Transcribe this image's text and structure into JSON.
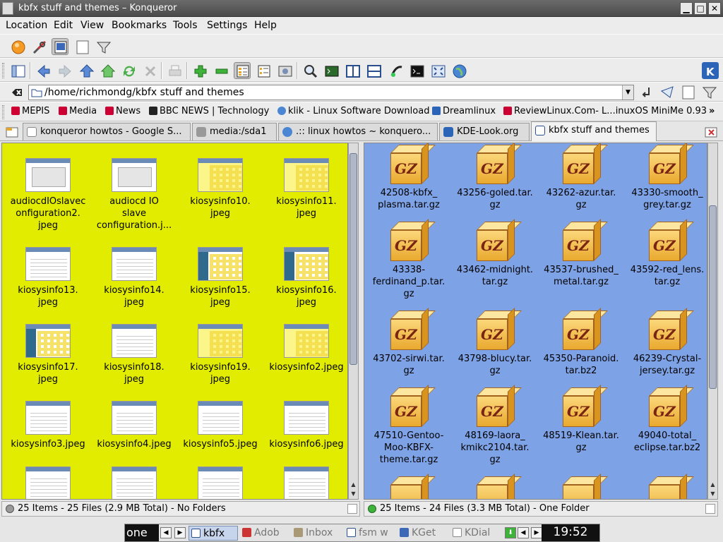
{
  "window": {
    "title": "kbfx stuff and themes – Konqueror"
  },
  "menubar": [
    "Location",
    "Edit",
    "View",
    "Bookmarks",
    "Tools",
    "Settings",
    "Help"
  ],
  "location": {
    "url": "/home/richmondg/kbfx stuff and themes"
  },
  "bookmarks": [
    "MEPIS",
    "Media",
    "News",
    "BBC NEWS | Technology",
    "klik - Linux Software Download",
    "Dreamlinux",
    "ReviewLinux.Com- L...inuxOS MiniMe 0.93",
    "»"
  ],
  "tabs": [
    "konqueror howtos - Google S...",
    "media:/sda1",
    ".:: linux howtos ~ konquero...",
    "KDE-Look.org",
    "kbfx stuff and themes"
  ],
  "active_tab_index": 4,
  "left_pane": {
    "background": "#e2ec00",
    "files": [
      [
        "audiocdIOslavec",
        "onfiguration2.",
        "jpeg"
      ],
      [
        "audiocd IO",
        "slave",
        "configuration.j..."
      ],
      [
        "kiosysinfo10.",
        "jpeg"
      ],
      [
        "kiosysinfo11.",
        "jpeg"
      ],
      [
        "kiosysinfo13.",
        "jpeg"
      ],
      [
        "kiosysinfo14.",
        "jpeg"
      ],
      [
        "kiosysinfo15.",
        "jpeg"
      ],
      [
        "kiosysinfo16.",
        "jpeg"
      ],
      [
        "kiosysinfo17.",
        "jpeg"
      ],
      [
        "kiosysinfo18.",
        "jpeg"
      ],
      [
        "kiosysinfo19.",
        "jpeg"
      ],
      [
        "kiosysinfo2.jpeg"
      ],
      [
        "kiosysinfo3.jpeg"
      ],
      [
        "kiosysinfo4.jpeg"
      ],
      [
        "kiosysinfo5.jpeg"
      ],
      [
        "kiosysinfo6.jpeg"
      ]
    ],
    "status": "25 Items - 25 Files (2.9 MB Total) - No Folders"
  },
  "right_pane": {
    "background": "#7ea2e6",
    "icon_text": "GZ",
    "files": [
      [
        "42508-kbfx_",
        "plasma.tar.gz"
      ],
      [
        "43256-goled.tar.",
        "gz"
      ],
      [
        "43262-azur.tar.",
        "gz"
      ],
      [
        "43330-smooth_",
        "grey.tar.gz"
      ],
      [
        "43338-",
        "ferdinand_p.tar.",
        "gz"
      ],
      [
        "43462-midnight.",
        "tar.gz"
      ],
      [
        "43537-brushed_",
        "metal.tar.gz"
      ],
      [
        "43592-red_lens.",
        "tar.gz"
      ],
      [
        "43702-sirwi.tar.",
        "gz"
      ],
      [
        "43798-blucy.tar.",
        "gz"
      ],
      [
        "45350-Paranoid.",
        "tar.bz2"
      ],
      [
        "46239-Crystal-",
        "jersey.tar.gz"
      ],
      [
        "47510-Gentoo-",
        "Moo-KBFX-",
        "theme.tar.gz"
      ],
      [
        "48169-laora_",
        "kmikc2104.tar.",
        "gz"
      ],
      [
        "48519-Klean.tar.",
        "gz"
      ],
      [
        "49040-total_",
        "eclipse.tar.bz2"
      ]
    ],
    "status": "25 Items - 24 Files (3.3 MB Total) - One Folder"
  },
  "taskbar": {
    "desktop": "one",
    "tasks": [
      "kbfx",
      "Adob",
      "Inbox",
      "fsm w",
      "KGet",
      "KDial"
    ],
    "clock": "19:52"
  },
  "icons": [
    "konqueror-icon",
    "configure-icon",
    "image-viewer-icon",
    "blank-page-icon",
    "filter-icon",
    "sidebar-icon",
    "back-icon",
    "forward-icon",
    "up-icon",
    "home-icon",
    "reload-icon",
    "stop-icon",
    "print-icon",
    "zoom-in-icon",
    "zoom-out-icon",
    "icon-view-icon",
    "detail-view-icon",
    "preview-icon",
    "find-icon",
    "terminal-icon",
    "split-vertical-icon",
    "split-horizontal-icon",
    "kget-icon",
    "konsole-icon",
    "fullscreen-icon",
    "web-icon",
    "kde-logo-icon"
  ]
}
